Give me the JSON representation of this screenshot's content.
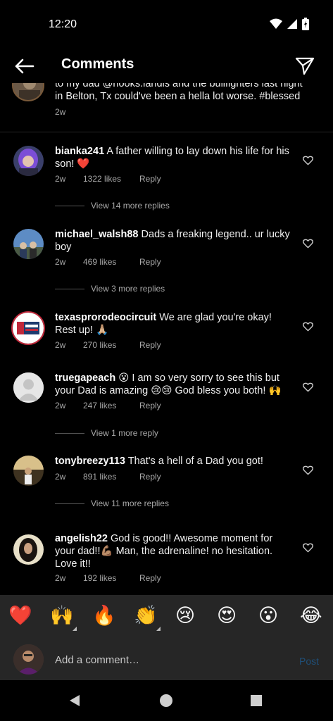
{
  "status": {
    "time": "12:20"
  },
  "header": {
    "title": "Comments"
  },
  "caption": {
    "text": "to my dad @hooks.landis and the bullfighters last night in Belton, Tx could've been a hella lot worse. #blessed",
    "time": "2w"
  },
  "comments": [
    {
      "username": "bianka241",
      "text": "A father willing to lay down his life for his son! ❤️",
      "time": "2w",
      "likes": "1322 likes",
      "reply": "Reply",
      "view_replies": "View 14 more replies"
    },
    {
      "username": "michael_walsh88",
      "text": "Dads a freaking legend.. ur lucky boy",
      "time": "2w",
      "likes": "469 likes",
      "reply": "Reply",
      "view_replies": "View 3 more replies"
    },
    {
      "username": "texasprorodeocircuit",
      "text": "We are glad you're okay! Rest up! 🙏🏼",
      "time": "2w",
      "likes": "270 likes",
      "reply": "Reply"
    },
    {
      "username": "truegapeach",
      "text": "😮 I am so very sorry to see this but your Dad is amazing 😢😢 God bless you both! 🙌",
      "time": "2w",
      "likes": "247 likes",
      "reply": "Reply",
      "view_replies": "View 1 more reply"
    },
    {
      "username": "tonybreezy113",
      "text": "That's a hell of a Dad you got!",
      "time": "2w",
      "likes": "891 likes",
      "reply": "Reply",
      "view_replies": "View 11 more replies"
    },
    {
      "username": "angelish22",
      "text": "God is good!! Awesome moment for your dad!!💪🏽 Man, the adrenaline!  no hesitation. Love it!!",
      "time": "2w",
      "likes": "192 likes",
      "reply": "Reply"
    }
  ],
  "emoji_bar": [
    "❤️",
    "🙌",
    "🔥",
    "👏",
    "😢",
    "😍",
    "😮",
    "😂"
  ],
  "compose": {
    "placeholder": "Add a comment…",
    "post_label": "Post"
  },
  "colors": {
    "background": "#000000",
    "panel": "#262626",
    "post_disabled": "#1f4f78",
    "heart": "#e0245e"
  }
}
